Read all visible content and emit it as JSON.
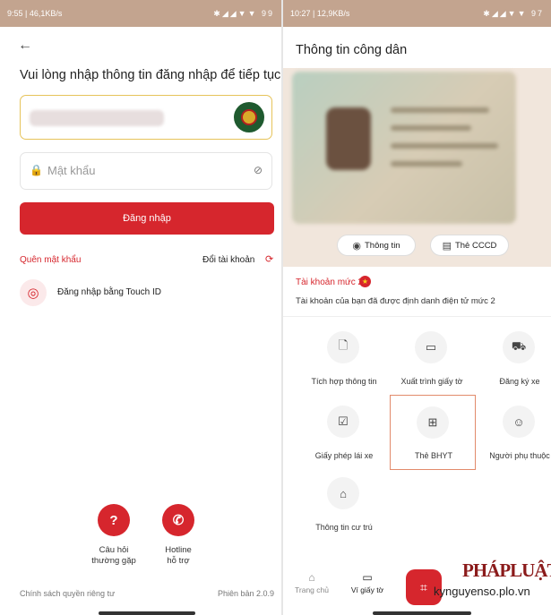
{
  "left": {
    "status_time": "9:55 | 46,1KB/s",
    "status_icons": "✱◢◢▼▼ 99",
    "back_icon": "←",
    "title": "Vui lòng nhập thông tin đăng nhập để tiếp tục",
    "password_placeholder": "Mật khẩu",
    "login_button": "Đăng nhập",
    "forgot_password": "Quên mật khẩu",
    "switch_account": "Đổi tài khoản",
    "touch_id": "Đăng nhập bằng Touch ID",
    "faq_line1": "Câu hỏi",
    "faq_line2": "thường gặp",
    "hotline_line1": "Hotline",
    "hotline_line2": "hỗ trợ",
    "privacy": "Chính sách quyền riêng tư",
    "version": "Phiên bản 2.0.9"
  },
  "right": {
    "status_time": "10:27 | 12,9KB/s",
    "status_icons": "✱◢◢▼▼ 97",
    "title": "Thông tin công dân",
    "info_chip": "Thông tin",
    "cccd_chip": "Thẻ CCCD",
    "account_level": "Tài khoản mức 2",
    "account_desc": "Tài khoản của bạn đã được định danh điện tử mức 2",
    "tiles": [
      {
        "label": "Tích hợp thông tin",
        "icon": "doc-plus-icon"
      },
      {
        "label": "Xuất trình giấy tờ",
        "icon": "id-card-icon"
      },
      {
        "label": "Đăng ký xe",
        "icon": "car-icon"
      },
      {
        "label": "Giấy phép lái xe",
        "icon": "license-icon"
      },
      {
        "label": "Thẻ BHYT",
        "icon": "health-card-icon"
      },
      {
        "label": "Người phụ thuộc",
        "icon": "person-icon"
      },
      {
        "label": "Thông tin cư trú",
        "icon": "home-icon"
      }
    ],
    "nav_home": "Trang chủ",
    "nav_wallet": "Ví giấy tờ"
  },
  "watermark": {
    "brand": "PHÁPLUẬT",
    "site": "kynguyenso.plo.vn"
  },
  "colors": {
    "brand_red": "#d6262d",
    "gold_border": "#e6c35a"
  }
}
